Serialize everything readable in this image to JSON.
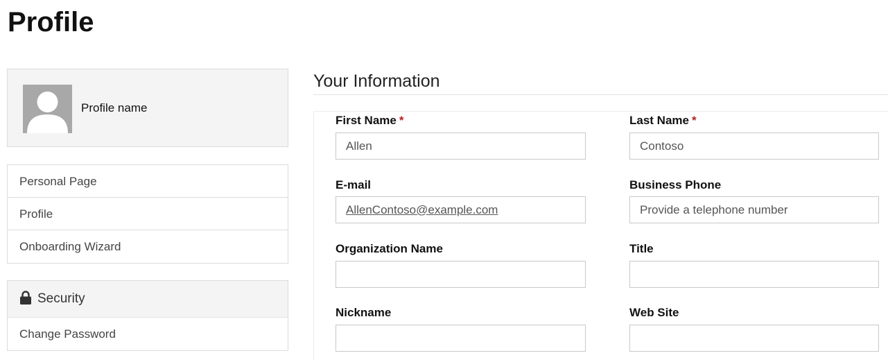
{
  "page": {
    "title": "Profile"
  },
  "profile_card": {
    "name": "Profile name",
    "avatar_icon": "person-silhouette-icon"
  },
  "nav": {
    "items": [
      {
        "label": "Personal Page"
      },
      {
        "label": "Profile"
      },
      {
        "label": "Onboarding Wizard"
      }
    ]
  },
  "security": {
    "icon": "lock-icon",
    "title": "Security",
    "link": "Change Password"
  },
  "form": {
    "section_title": "Your Information",
    "required_marker": "*",
    "first_name": {
      "label": "First Name",
      "value": "Allen"
    },
    "last_name": {
      "label": "Last Name",
      "value": "Contoso"
    },
    "email": {
      "label": "E-mail",
      "value": "AllenContoso@example.com"
    },
    "business_phone": {
      "label": "Business Phone",
      "value": "",
      "placeholder": "Provide a telephone number"
    },
    "organization_name": {
      "label": "Organization Name",
      "value": ""
    },
    "title": {
      "label": "Title",
      "value": ""
    },
    "nickname": {
      "label": "Nickname",
      "value": ""
    },
    "web_site": {
      "label": "Web Site",
      "value": ""
    }
  },
  "colors": {
    "required": "#b22222",
    "panel_background": "#f4f4f4",
    "avatar_background": "#a8a8a8",
    "border": "#dcdcdc"
  }
}
